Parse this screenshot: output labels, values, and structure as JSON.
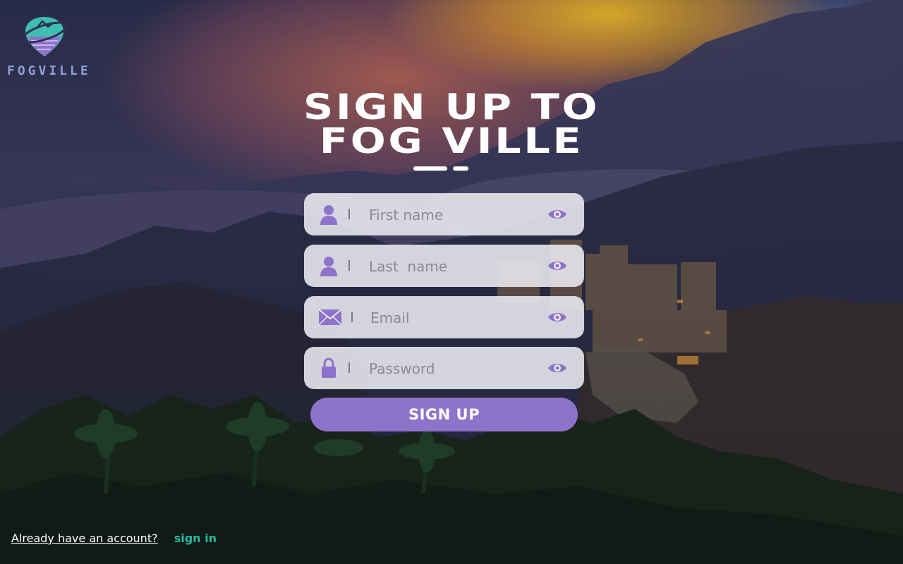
{
  "brand": {
    "name": "FOGVILLE"
  },
  "title": {
    "line1": "SIGN UP TO",
    "line2": "FOG VILLE"
  },
  "form": {
    "first_name": {
      "placeholder": "First name",
      "icon": "user-icon"
    },
    "last_name": {
      "placeholder": "Last  name",
      "icon": "user-icon"
    },
    "email": {
      "placeholder": "Email",
      "icon": "envelope-icon"
    },
    "password": {
      "placeholder": "Password",
      "icon": "lock-icon"
    },
    "submit_label": "SIGN UP"
  },
  "footer": {
    "already_text": "Already have an account?",
    "signin_label": "sign in"
  },
  "colors": {
    "accent": "#8d73c9",
    "icon": "#8d73c9",
    "link": "#2bb6a6"
  }
}
